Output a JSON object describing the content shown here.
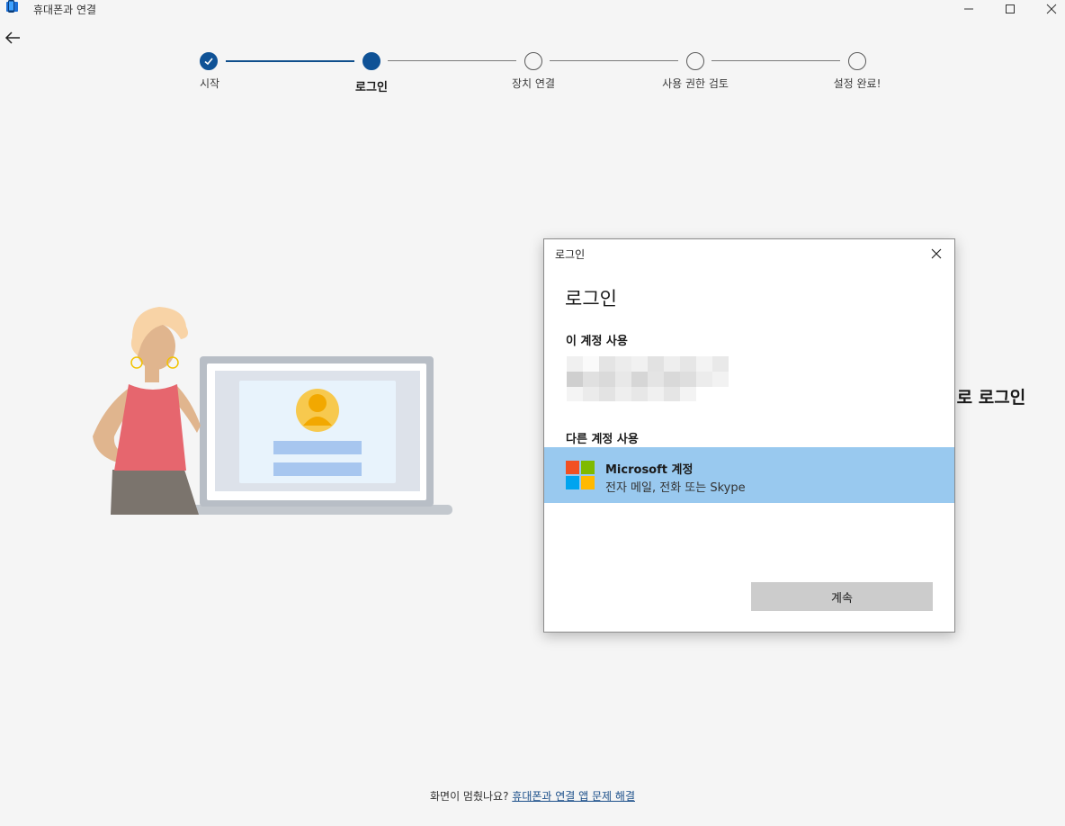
{
  "window": {
    "title": "휴대폰과 연결",
    "icon": "phone-link-app-icon"
  },
  "stepper": {
    "steps": [
      {
        "label": "시작",
        "state": "done"
      },
      {
        "label": "로그인",
        "state": "current"
      },
      {
        "label": "장치 연결",
        "state": "pending"
      },
      {
        "label": "사용 권한 검토",
        "state": "pending"
      },
      {
        "label": "설정 완료!",
        "state": "pending"
      }
    ]
  },
  "main": {
    "heading_partial": ")로 로그인"
  },
  "dialog": {
    "caption": "로그인",
    "title": "로그인",
    "use_this_account": "이 계정 사용",
    "use_other_account": "다른 계정 사용",
    "ms_option": {
      "title": "Microsoft 계정",
      "subtitle": "전자 메일, 전화 또는 Skype"
    },
    "continue_label": "계속"
  },
  "footer": {
    "question": "화면이 멈췄나요?",
    "link": "휴대폰과 연결 앱 문제 해결"
  },
  "colors": {
    "accent": "#0f5296",
    "selected_option": "#99c9ef",
    "button": "#cccccc"
  }
}
